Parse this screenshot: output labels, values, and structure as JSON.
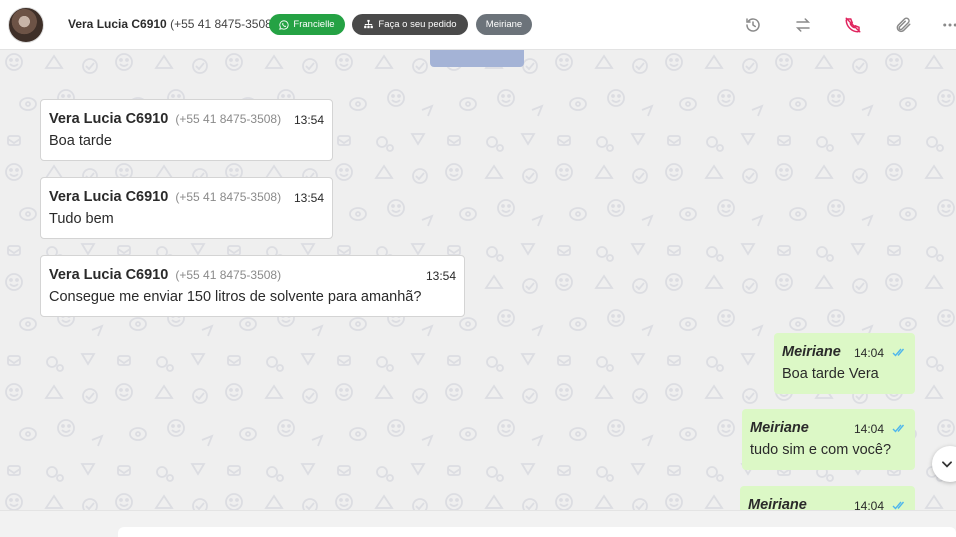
{
  "header": {
    "contact_name": "Vera Lucia C6910",
    "contact_phone": "(+55 41 8475-3508)",
    "tags": {
      "whatsapp": "Francielle",
      "order": "Faça o seu pedido",
      "user": "Meiriane"
    },
    "icons": [
      "history-icon",
      "transfer-icon",
      "end-call-icon",
      "attach-icon",
      "more-icon"
    ],
    "colors": {
      "whatsapp_tag": "#25a244",
      "order_tag": "#4a4a4a",
      "user_tag": "#6c737a",
      "end_call": "#e0245e"
    }
  },
  "messages": {
    "incoming": [
      {
        "sender": "Vera Lucia C6910",
        "phone": "(+55 41 8475-3508)",
        "time": "13:54",
        "text": "Boa tarde"
      },
      {
        "sender": "Vera Lucia C6910",
        "phone": "(+55 41 8475-3508)",
        "time": "13:54",
        "text": "Tudo bem"
      },
      {
        "sender": "Vera Lucia C6910",
        "phone": "(+55 41 8475-3508)",
        "time": "13:54",
        "text": "Consegue me enviar 150 litros de solvente para amanhã?"
      }
    ],
    "outgoing": [
      {
        "sender": "Meiriane",
        "time": "14:04",
        "text": "Boa tarde Vera",
        "status": "read"
      },
      {
        "sender": "Meiriane",
        "time": "14:04",
        "text": "tudo sim e com você?",
        "status": "read"
      },
      {
        "sender": "Meiriane",
        "time": "14:04",
        "text": "",
        "status": "read"
      }
    ],
    "colors": {
      "incoming_bg": "#ffffff",
      "outgoing_bg": "#dcf8c6",
      "read_check": "#4fb6ec"
    }
  }
}
